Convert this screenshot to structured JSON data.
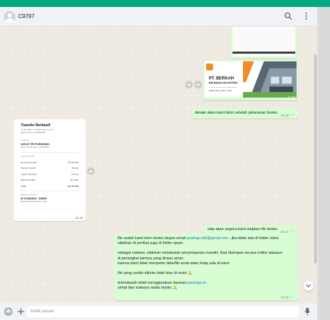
{
  "header": {
    "contact_name": "C9797"
  },
  "messages": {
    "img_top_time": "23.10",
    "banner": {
      "company": "PT. BERKAH",
      "company2": "BHUMANA SEJAHTERA",
      "small": "OPEN DAILY 8 AM - 9 PM",
      "time": "23.10"
    },
    "caption": {
      "text": "desain akan kami kirim setelah pelunasan bosku",
      "time": "23.18"
    },
    "receipt": {
      "title": "Transfer Berhasil!",
      "date": "15 Mei 2023 • 23:05:56 WIB • No. Ref",
      "ref": "Bank Transfer • 1234567890",
      "to_label": "Penerima",
      "recipient": "AGUS TRI PURNOMO",
      "recipient_sub": "Bank Central Asia • 1234567890",
      "details_label": "Detail Transaksi",
      "rows": [
        {
          "label": "Nominal Transfer",
          "value": "Rp 200.000"
        },
        {
          "label": "Metode Transfer",
          "value": "BI-Fast"
        },
        {
          "label": "Tujuan Transaksi",
          "value": "Lainnya"
        },
        {
          "label": "Biaya Transaksi",
          "value": "Rp 2.500"
        },
        {
          "label": "Total",
          "value": "Rp 202.500"
        }
      ],
      "sender_label": "Rekening Sumber",
      "sender": "M SYAMSUL 'ARIEF",
      "sender_sub": "Bank Rakyat Indonesia • 1234",
      "time": "23.19"
    },
    "reply1": {
      "text": "siap akan segera kami siapkan file bosku",
      "time": "23.21"
    },
    "long": {
      "p1a": "file sudah kami kirim bosku degan email ",
      "email": "jasalogo.id6@gmail.com",
      "p1b": " . jika tidak ada di folder inbox",
      "p1c": "silahkan di periksa juga di folder spam.",
      "p2a": "sebagai catatan, silahkan melakukan penyimpanan mandiri, bisa disimpan secara online ataupun",
      "p2b": "di perangkat lainnya yang dirasa aman .",
      "p2c": "karena kami tidak menjamin data/file anda akan tetap ada di kami.",
      "p3": "file yang sudah dikirim tidak bisa di revisi 🙏",
      "p4a": "terimakasih telah menggunakan layanan ",
      "site": "jasalogo.id",
      "p4b": " .",
      "p4c": "sehat dan sukesss selalu bosku 🙏",
      "time": "23.21"
    }
  },
  "composer": {
    "placeholder": "Ketik pesan"
  },
  "colors": {
    "accent": "#00a884",
    "outgoing": "#d9fdd3",
    "incoming": "#ffffff",
    "link": "#027eb5",
    "tick": "#53bdeb"
  }
}
